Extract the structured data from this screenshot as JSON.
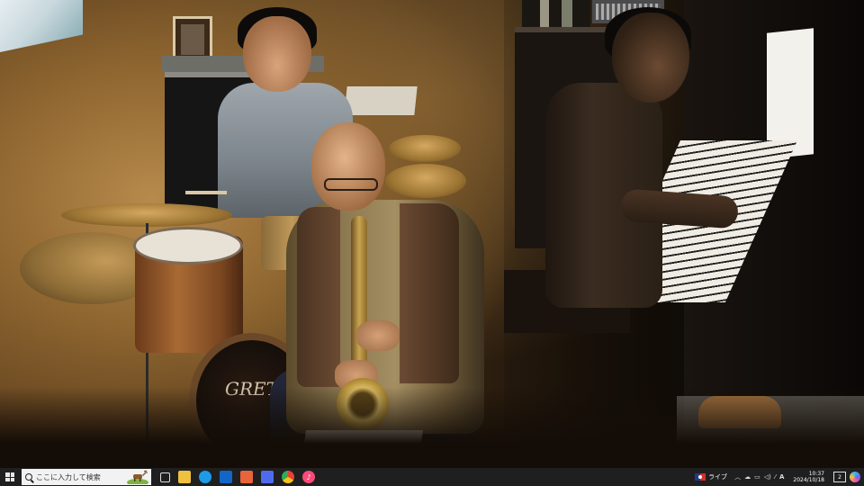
{
  "video": {
    "scene": "jazz trio performing",
    "bass_drum_logo": "GRETSCH"
  },
  "taskbar": {
    "search_placeholder": "ここに入力して検索",
    "tray": {
      "live_label": "ライブ",
      "time": "10:37",
      "date": "2024/10/18",
      "notification_count": "2"
    },
    "app_colors": {
      "file_explorer": "#f0c040",
      "edge": "#1c9be8",
      "outlook": "#1266c8",
      "app_orange": "#e8643a",
      "app_blue": "#4f6bed",
      "chrome": "#e84234",
      "itunes": "#fa4a7a"
    }
  }
}
